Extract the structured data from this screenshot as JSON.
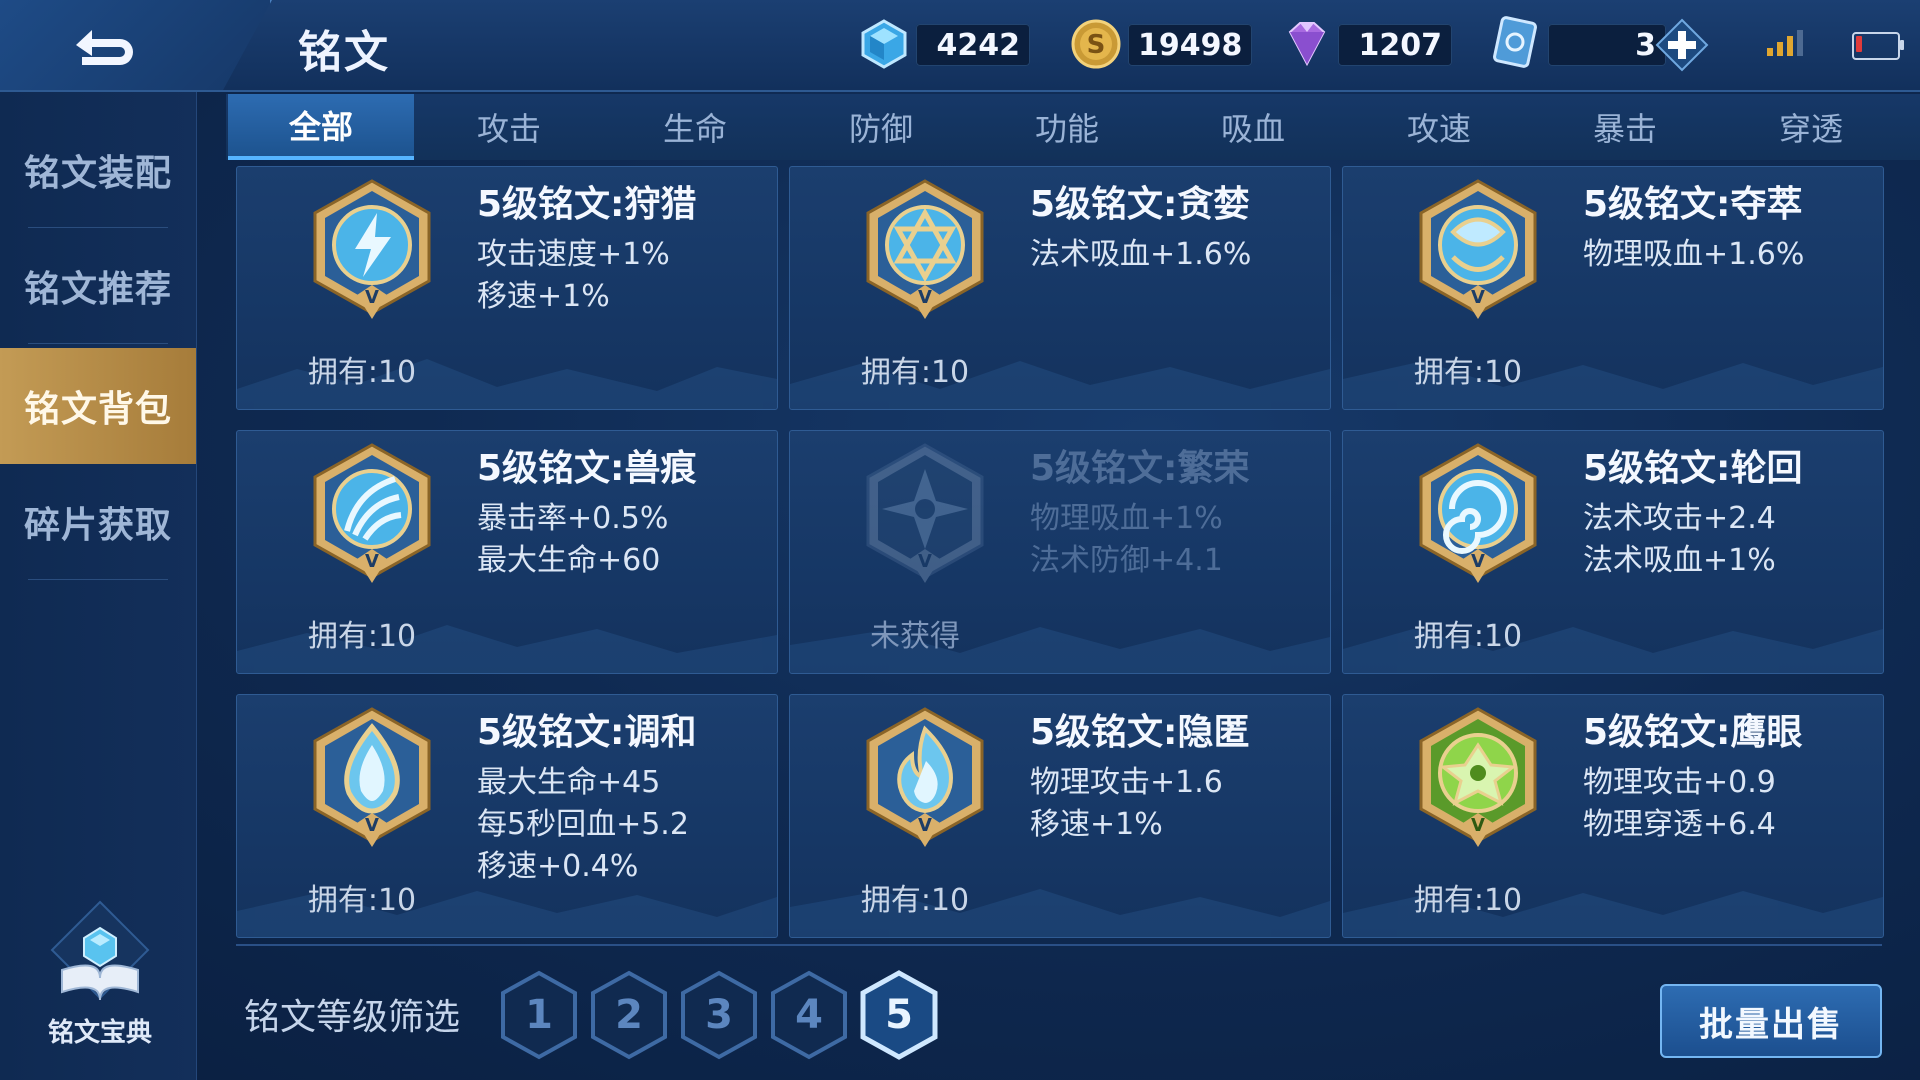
{
  "header": {
    "title": "铭文",
    "resources": [
      {
        "icon": "crystal-icon",
        "value": "4242"
      },
      {
        "icon": "gold-coin-icon",
        "value": "19498"
      },
      {
        "icon": "diamond-icon",
        "value": "1207"
      },
      {
        "icon": "ticket-card-icon",
        "value": "3"
      }
    ]
  },
  "sidebar": {
    "items": [
      {
        "label": "铭文装配"
      },
      {
        "label": "铭文推荐"
      },
      {
        "label": "铭文背包",
        "active": true
      },
      {
        "label": "碎片获取"
      }
    ],
    "codex_label": "铭文宝典"
  },
  "tabs": [
    {
      "label": "全部",
      "active": true
    },
    {
      "label": "攻击"
    },
    {
      "label": "生命"
    },
    {
      "label": "防御"
    },
    {
      "label": "功能"
    },
    {
      "label": "吸血"
    },
    {
      "label": "攻速"
    },
    {
      "label": "暴击"
    },
    {
      "label": "穿透"
    }
  ],
  "inscriptions": [
    {
      "name": "5级铭文:狩猎",
      "stats": [
        "攻击速度+1%",
        "移速+1%"
      ],
      "owned": "拥有:10",
      "icon": "lightning-emblem-icon",
      "color": "#5fc2ee"
    },
    {
      "name": "5级铭文:贪婪",
      "stats": [
        "法术吸血+1.6%"
      ],
      "owned": "拥有:10",
      "icon": "star-emblem-icon",
      "color": "#5fc2ee"
    },
    {
      "name": "5级铭文:夺萃",
      "stats": [
        "物理吸血+1.6%"
      ],
      "owned": "拥有:10",
      "icon": "knot-emblem-icon",
      "color": "#5fc2ee"
    },
    {
      "name": "5级铭文:兽痕",
      "stats": [
        "暴击率+0.5%",
        "最大生命+60"
      ],
      "owned": "拥有:10",
      "icon": "claw-emblem-icon",
      "color": "#5fc2ee"
    },
    {
      "name": "5级铭文:繁荣",
      "stats": [
        "物理吸血+1%",
        "法术防御+4.1"
      ],
      "owned": "未获得",
      "icon": "compass-emblem-icon",
      "color": "#5fc2ee",
      "locked": true
    },
    {
      "name": "5级铭文:轮回",
      "stats": [
        "法术攻击+2.4",
        "法术吸血+1%"
      ],
      "owned": "拥有:10",
      "icon": "swirl-emblem-icon",
      "color": "#5fc2ee"
    },
    {
      "name": "5级铭文:调和",
      "stats": [
        "最大生命+45",
        "每5秒回血+5.2",
        "移速+0.4%"
      ],
      "owned": "拥有:10",
      "icon": "droplet-emblem-icon",
      "color": "#5fc2ee"
    },
    {
      "name": "5级铭文:隐匿",
      "stats": [
        "物理攻击+1.6",
        "移速+1%"
      ],
      "owned": "拥有:10",
      "icon": "flame-emblem-icon",
      "color": "#5fc2ee"
    },
    {
      "name": "5级铭文:鹰眼",
      "stats": [
        "物理攻击+0.9",
        "物理穿透+6.4"
      ],
      "owned": "拥有:10",
      "icon": "eagle-emblem-icon",
      "color": "#8fd54a"
    }
  ],
  "footer": {
    "filter_label": "铭文等级筛选",
    "levels": [
      "1",
      "2",
      "3",
      "4",
      "5"
    ],
    "active_level": "5",
    "sell_label": "批量出售"
  },
  "colors": {
    "accent_gold": "#c39b55",
    "accent_blue": "#2d6cb2",
    "emblem_gold": "#d9b06a",
    "green_emblem": "#8fd54a"
  }
}
